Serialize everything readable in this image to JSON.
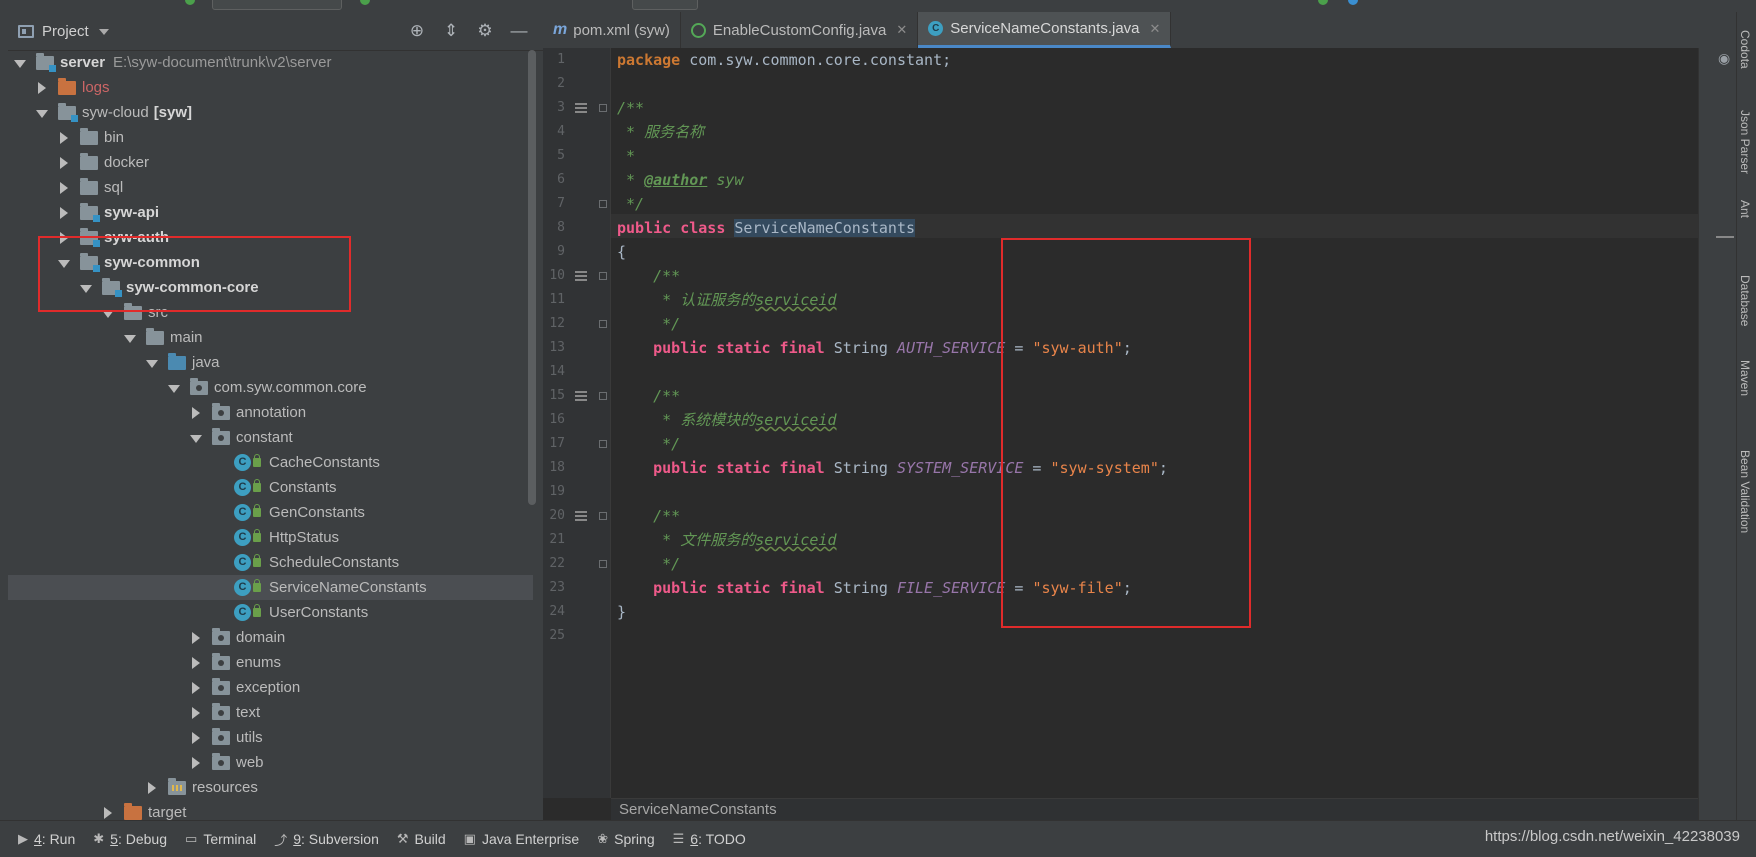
{
  "project_panel": {
    "title": "Project",
    "tree": [
      {
        "label": "server",
        "extra": "E:\\syw-document\\trunk\\v2\\server",
        "depth": 0,
        "arrow": "d",
        "icon": "module",
        "bold": true
      },
      {
        "label": "logs",
        "depth": 1,
        "arrow": "r",
        "icon": "folder-orange",
        "red": true
      },
      {
        "label": "syw-cloud",
        "extra": "[syw]",
        "depth": 1,
        "arrow": "d",
        "icon": "module"
      },
      {
        "label": "bin",
        "depth": 2,
        "arrow": "r",
        "icon": "folder"
      },
      {
        "label": "docker",
        "depth": 2,
        "arrow": "r",
        "icon": "folder"
      },
      {
        "label": "sql",
        "depth": 2,
        "arrow": "r",
        "icon": "folder"
      },
      {
        "label": "syw-api",
        "depth": 2,
        "arrow": "r",
        "icon": "module",
        "bold": true
      },
      {
        "label": "syw-auth",
        "depth": 2,
        "arrow": "r",
        "icon": "module",
        "bold": true
      },
      {
        "label": "syw-common",
        "depth": 2,
        "arrow": "d",
        "icon": "module",
        "bold": true
      },
      {
        "label": "syw-common-core",
        "depth": 3,
        "arrow": "d",
        "icon": "module",
        "bold": true
      },
      {
        "label": "src",
        "depth": 4,
        "arrow": "d",
        "icon": "folder"
      },
      {
        "label": "main",
        "depth": 5,
        "arrow": "d",
        "icon": "folder"
      },
      {
        "label": "java",
        "depth": 6,
        "arrow": "d",
        "icon": "folder-blue"
      },
      {
        "label": "com.syw.common.core",
        "depth": 7,
        "arrow": "d",
        "icon": "package"
      },
      {
        "label": "annotation",
        "depth": 8,
        "arrow": "r",
        "icon": "package"
      },
      {
        "label": "constant",
        "depth": 8,
        "arrow": "d",
        "icon": "package"
      },
      {
        "label": "CacheConstants",
        "depth": 9,
        "arrow": "n",
        "icon": "class"
      },
      {
        "label": "Constants",
        "depth": 9,
        "arrow": "n",
        "icon": "class"
      },
      {
        "label": "GenConstants",
        "depth": 9,
        "arrow": "n",
        "icon": "class"
      },
      {
        "label": "HttpStatus",
        "depth": 9,
        "arrow": "n",
        "icon": "class"
      },
      {
        "label": "ScheduleConstants",
        "depth": 9,
        "arrow": "n",
        "icon": "class"
      },
      {
        "label": "ServiceNameConstants",
        "depth": 9,
        "arrow": "n",
        "icon": "class",
        "selected": true
      },
      {
        "label": "UserConstants",
        "depth": 9,
        "arrow": "n",
        "icon": "class"
      },
      {
        "label": "domain",
        "depth": 8,
        "arrow": "r",
        "icon": "package"
      },
      {
        "label": "enums",
        "depth": 8,
        "arrow": "r",
        "icon": "package"
      },
      {
        "label": "exception",
        "depth": 8,
        "arrow": "r",
        "icon": "package"
      },
      {
        "label": "text",
        "depth": 8,
        "arrow": "r",
        "icon": "package"
      },
      {
        "label": "utils",
        "depth": 8,
        "arrow": "r",
        "icon": "package"
      },
      {
        "label": "web",
        "depth": 8,
        "arrow": "r",
        "icon": "package"
      },
      {
        "label": "resources",
        "depth": 6,
        "arrow": "r",
        "icon": "folder-res"
      },
      {
        "label": "target",
        "depth": 4,
        "arrow": "r",
        "icon": "folder-orange"
      }
    ]
  },
  "tabs": [
    {
      "icon": "m",
      "label": "pom.xml (syw)"
    },
    {
      "icon": "g",
      "label": "EnableCustomConfig.java"
    },
    {
      "icon": "c",
      "label": "ServiceNameConstants.java",
      "active": true
    }
  ],
  "editor": {
    "line_numbers": [
      "1",
      "2",
      "3",
      "4",
      "5",
      "6",
      "7",
      "8",
      "9",
      "10",
      "11",
      "12",
      "13",
      "14",
      "15",
      "16",
      "17",
      "18",
      "19",
      "20",
      "21",
      "22",
      "23",
      "24",
      "25"
    ],
    "code": {
      "l1_kw": "package",
      "l1_rest": " com.syw.common.core.constant;",
      "l3": "/**",
      "l4": " * 服务名称",
      "l5": " *",
      "l6_star": " * ",
      "l6_tag": "@author",
      "l6_rest": " syw",
      "l7": " */",
      "l8_kw1": "public",
      "l8_kw2": "class",
      "l8_name": "ServiceNameConstants",
      "l9": "{",
      "l10": "    /**",
      "l11_pre": "     * 认证服务的",
      "l11_und": "serviceid",
      "l12": "     */",
      "l13_kw": "    public static final",
      "l13_type": " String ",
      "l13_const": "AUTH_SERVICE",
      "l13_eq": " = ",
      "l13_str": "\"syw-auth\"",
      "l13_end": ";",
      "l15": "    /**",
      "l16_pre": "     * 系统模块的",
      "l16_und": "serviceid",
      "l17": "     */",
      "l18_kw": "    public static final",
      "l18_type": " String ",
      "l18_const": "SYSTEM_SERVICE",
      "l18_eq": " = ",
      "l18_str": "\"syw-system\"",
      "l18_end": ";",
      "l20": "    /**",
      "l21_pre": "     * 文件服务的",
      "l21_und": "serviceid",
      "l22": "     */",
      "l23_kw": "    public static final",
      "l23_type": " String ",
      "l23_const": "FILE_SERVICE",
      "l23_eq": " = ",
      "l23_str": "\"syw-file\"",
      "l23_end": ";",
      "l24": "}"
    },
    "breadcrumb": "ServiceNameConstants"
  },
  "right_tools": [
    "Codota",
    "Json Parser",
    "Ant",
    "Database",
    "Maven",
    "Bean Validation"
  ],
  "bottom_tools": [
    {
      "num": "4",
      "label": ": Run"
    },
    {
      "num": "5",
      "label": ": Debug"
    },
    {
      "num": "",
      "label": "Terminal"
    },
    {
      "num": "9",
      "label": ": Subversion"
    },
    {
      "num": "",
      "label": "Build"
    },
    {
      "num": "",
      "label": "Java Enterprise"
    },
    {
      "num": "",
      "label": "Spring"
    },
    {
      "num": "6",
      "label": ": TODO"
    }
  ],
  "watermark": "https://blog.csdn.net/weixin_42238039",
  "colors": {
    "annotation_box": "#e02b2b",
    "accent": "#4a88c7"
  }
}
